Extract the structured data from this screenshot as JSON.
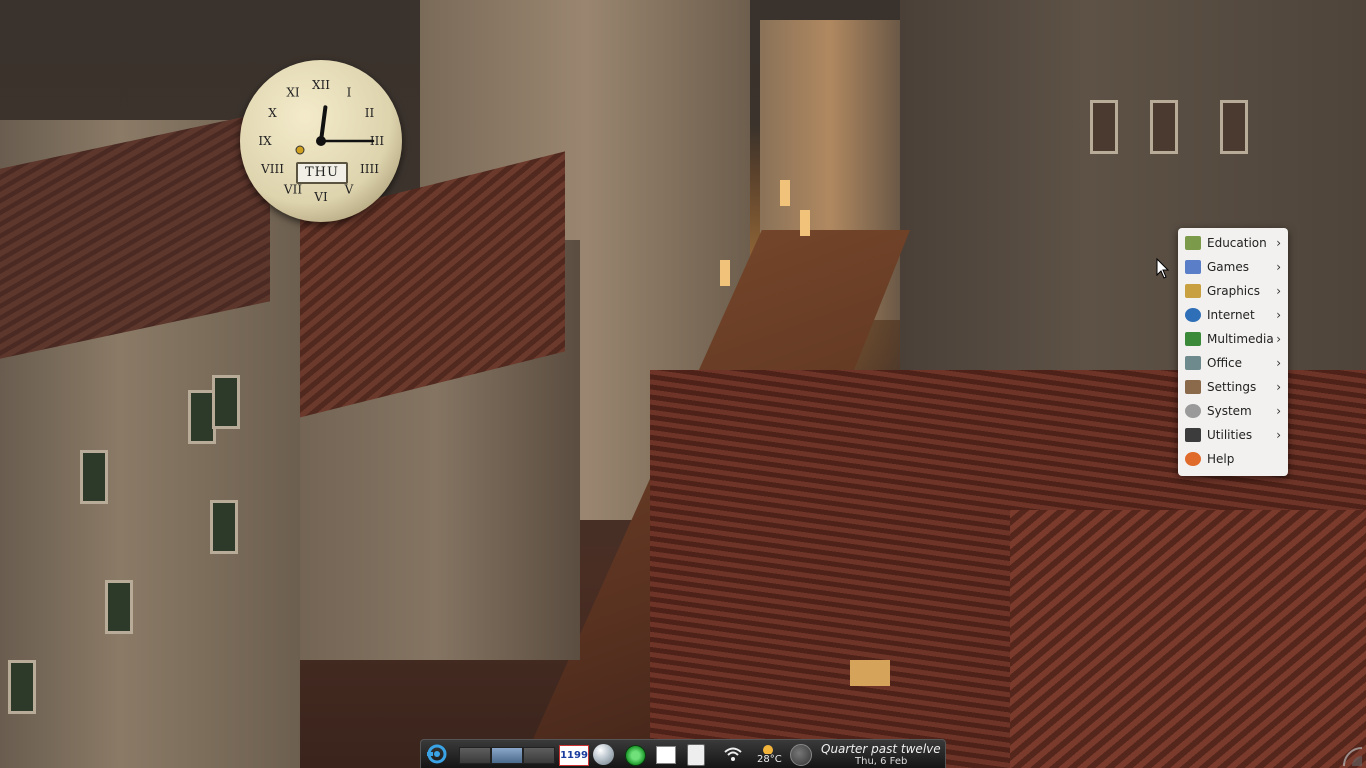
{
  "desktop": {
    "clock_widget": {
      "day": "THU",
      "time_hour": 12,
      "time_minute": 15,
      "numerals": [
        "XII",
        "I",
        "II",
        "III",
        "IIII",
        "V",
        "VI",
        "VII",
        "VIII",
        "IX",
        "X",
        "XI"
      ]
    }
  },
  "app_menu": {
    "items": [
      {
        "label": "Education",
        "icon": "education-icon",
        "color": "#7c9b4a",
        "has_submenu": true
      },
      {
        "label": "Games",
        "icon": "games-icon",
        "color": "#5a7ec8",
        "has_submenu": true
      },
      {
        "label": "Graphics",
        "icon": "graphics-icon",
        "color": "#c8a040",
        "has_submenu": true
      },
      {
        "label": "Internet",
        "icon": "internet-icon",
        "color": "#2f6fb8",
        "has_submenu": true
      },
      {
        "label": "Multimedia",
        "icon": "multimedia-icon",
        "color": "#3a8a3a",
        "has_submenu": true
      },
      {
        "label": "Office",
        "icon": "office-icon",
        "color": "#6f8a8c",
        "has_submenu": true
      },
      {
        "label": "Settings",
        "icon": "settings-icon",
        "color": "#8a6a4a",
        "has_submenu": true
      },
      {
        "label": "System",
        "icon": "system-icon",
        "color": "#9a9a9a",
        "has_submenu": true
      },
      {
        "label": "Utilities",
        "icon": "utilities-icon",
        "color": "#3c3c3c",
        "has_submenu": true
      },
      {
        "label": "Help",
        "icon": "help-icon",
        "color": "#e06a2a",
        "has_submenu": false
      }
    ],
    "arrow": "›"
  },
  "panel": {
    "calendar_badge": "1199",
    "weather_temp": "28°C",
    "clock_text": "Quarter past twelve",
    "date_text": "Thu, 6 Feb"
  }
}
